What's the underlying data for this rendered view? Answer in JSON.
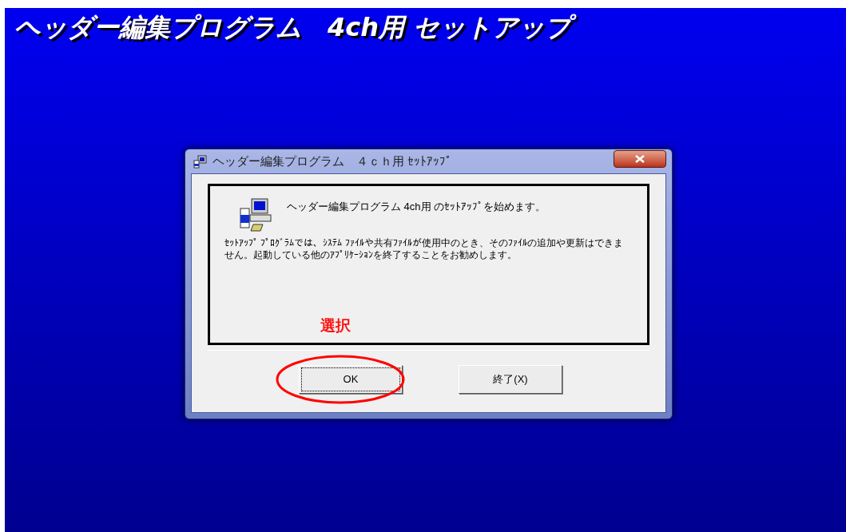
{
  "banner": {
    "title": "ヘッダー編集プログラム　4ch用 セットアップ"
  },
  "dialog": {
    "title": "ヘッダー編集プログラム　４ｃｈ用 ｾｯﾄｱｯﾌﾟ",
    "heading": "ヘッダー編集プログラム  4ch用 のｾｯﾄｱｯﾌﾟを始めます。",
    "body": "ｾｯﾄｱｯﾌﾟ ﾌﾟﾛｸﾞﾗﾑでは、ｼｽﾃﾑ ﾌｧｲﾙや共有ﾌｧｲﾙが使用中のとき、そのﾌｧｲﾙの追加や更新はできません。起動している他のｱﾌﾟﾘｹｰｼｮﾝを終了することをお勧めします。",
    "buttons": [
      {
        "label": "OK",
        "focused": true
      },
      {
        "label": "終了(X)",
        "focused": false
      }
    ]
  },
  "annotation": {
    "label": "選択"
  }
}
